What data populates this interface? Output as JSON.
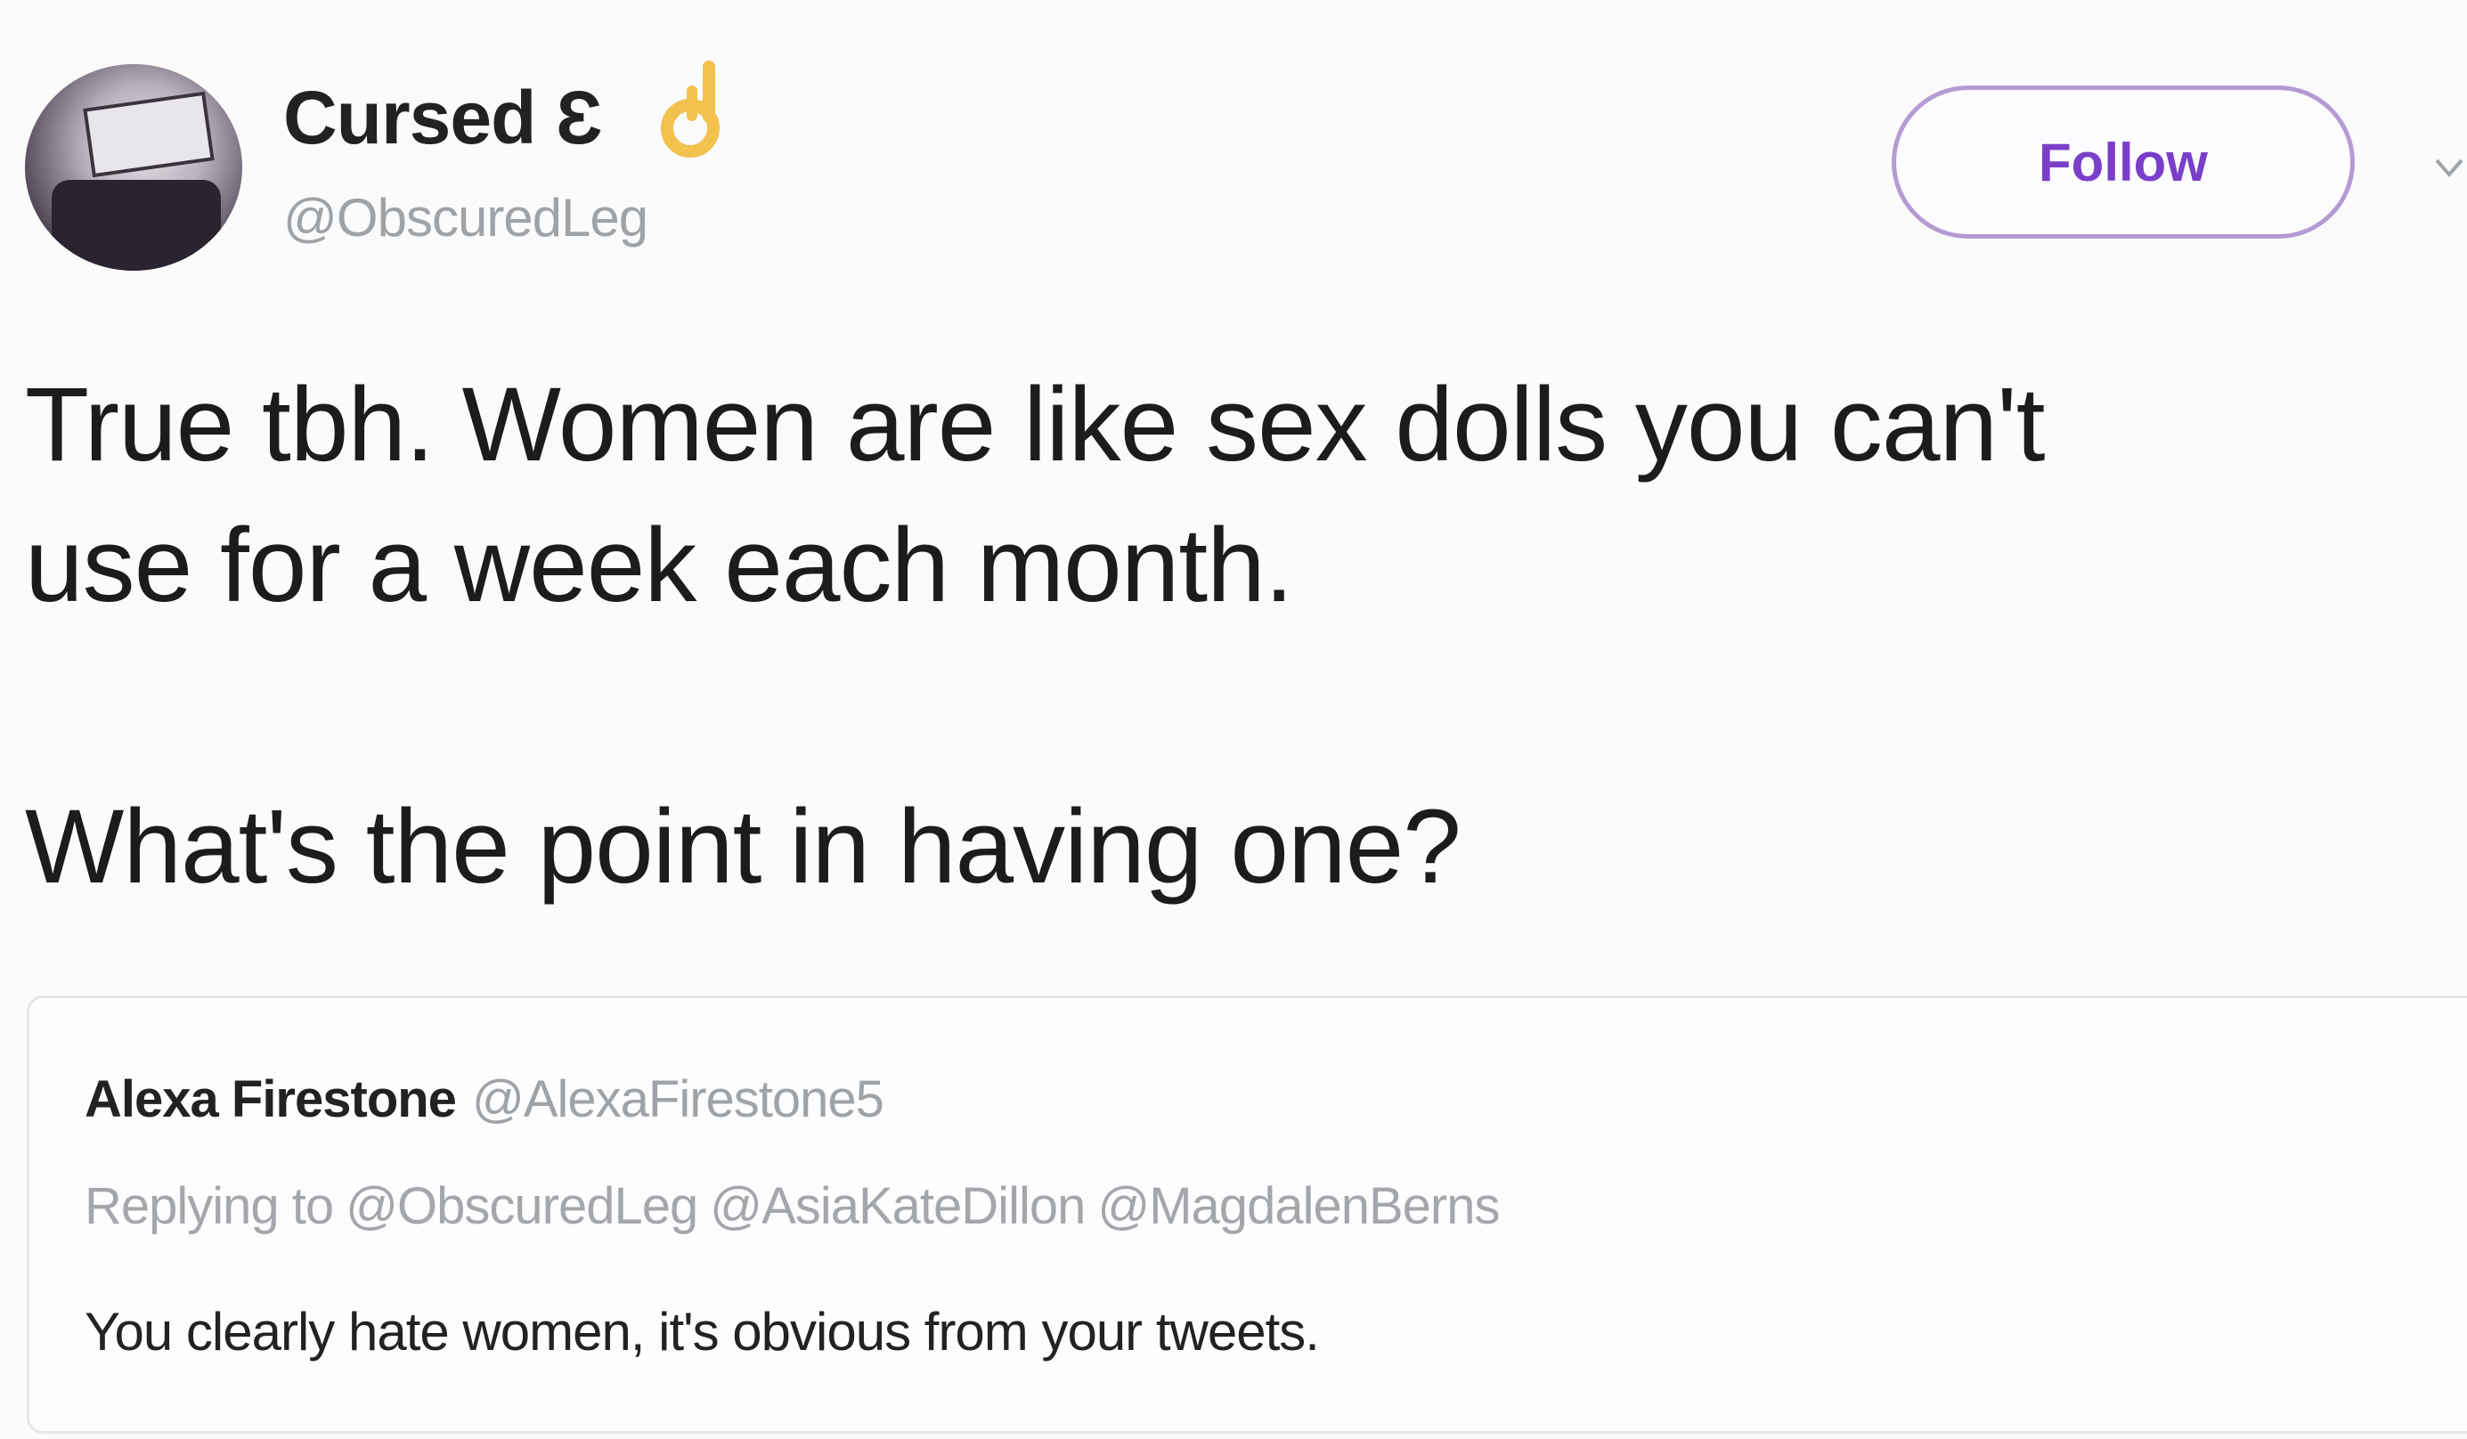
{
  "author": {
    "display_name": "Cursed Ɛ",
    "emoji_icon": "ok-hand-emoji",
    "handle": "@ObscuredLeg"
  },
  "actions": {
    "follow_label": "Follow",
    "chevron_icon": "chevron-down-icon"
  },
  "tweet": {
    "paragraph_1": "True tbh. Women are like sex dolls you can't\nuse for a week each month.",
    "paragraph_2": "What's the point in having one?"
  },
  "quoted_tweet": {
    "name": "Alexa Firestone",
    "handle": "@AlexaFirestone5",
    "replying_prefix": "Replying to",
    "replying_mentions": [
      "@ObscuredLeg",
      "@AsiaKateDillon",
      "@MagdalenBerns"
    ],
    "body": "You clearly hate women, it's obvious from your tweets."
  },
  "colors": {
    "follow_accent": "#7a3fc9",
    "follow_border": "#b49bd4",
    "handle_gray": "#9ea3a8",
    "text": "#1c1c1c"
  }
}
